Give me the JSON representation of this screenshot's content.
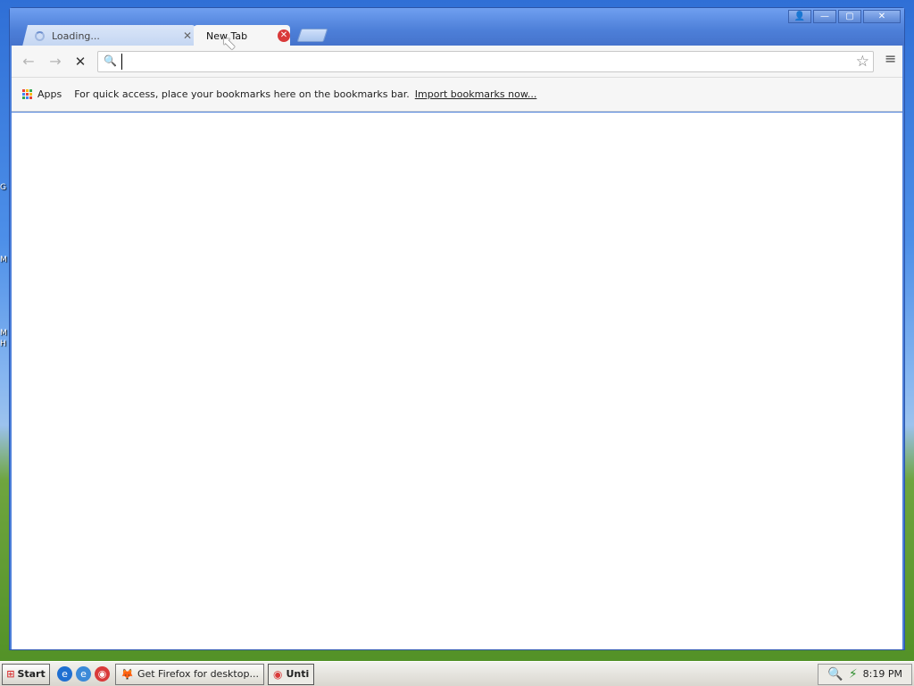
{
  "desktop": {
    "fragments": [
      "G",
      "M",
      "M",
      "H"
    ]
  },
  "window": {
    "tabs": [
      {
        "label": "Loading...",
        "state": "loading"
      },
      {
        "label": "New Tab",
        "state": "active"
      }
    ],
    "window_buttons": {
      "profile": "👤",
      "minimize": "—",
      "maximize": "▢",
      "close": "✕"
    }
  },
  "toolbar": {
    "back": "←",
    "forward": "→",
    "stop": "✕",
    "search_icon": "🔍",
    "omnibox_value": "",
    "omnibox_placeholder": "",
    "star": "☆",
    "menu": "≡"
  },
  "bookmarks": {
    "apps_label": "Apps",
    "hint": "For quick access, place your bookmarks here on the bookmarks bar.",
    "import_link": "Import bookmarks now...",
    "apps_colors": [
      "#e94235",
      "#fbbc05",
      "#34a853",
      "#4285f4",
      "#e94235",
      "#fbbc05",
      "#34a853",
      "#4285f4",
      "#e94235"
    ]
  },
  "taskbar": {
    "start_label": "Start",
    "quick_launch": [
      {
        "icon": "ie-icon",
        "glyph": "e",
        "color": "#1f6fd1"
      },
      {
        "icon": "outlook-icon",
        "glyph": "e",
        "color": "#3b8ad8"
      },
      {
        "icon": "chrome-icon",
        "glyph": "◉",
        "color": "#d93a3a"
      }
    ],
    "items": [
      {
        "label": "Get Firefox for desktop...",
        "active": false
      },
      {
        "label": "Unti",
        "active": true
      }
    ],
    "clock": "8:19 PM"
  },
  "colors": {
    "accent": "#4c7fd9",
    "close_red": "#d93a3a"
  }
}
